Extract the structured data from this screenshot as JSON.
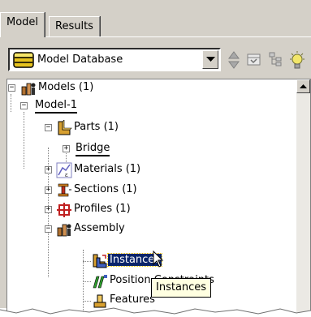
{
  "tabs": [
    {
      "label": "Model",
      "active": true
    },
    {
      "label": "Results",
      "active": false
    }
  ],
  "toolbar": {
    "database_combo": {
      "value": "Model Database",
      "icon": "database-icon"
    },
    "buttons": [
      "up-down-arrows-icon",
      "filter-tree-icon",
      "hierarchy-icon",
      "light-bulb-icon"
    ]
  },
  "tree": {
    "models": {
      "label": "Models (1)",
      "expanded": true
    },
    "model": {
      "label": "Model-1",
      "expanded": true
    },
    "parts": {
      "label": "Parts (1)",
      "expanded": true
    },
    "bridge": {
      "label": "Bridge",
      "expanded": false
    },
    "materials": {
      "label": "Materials (1)"
    },
    "sections": {
      "label": "Sections (1)"
    },
    "profiles": {
      "label": "Profiles (1)"
    },
    "assembly": {
      "label": "Assembly",
      "expanded": true
    },
    "instances": {
      "label": "Instances",
      "selected": true
    },
    "positions": {
      "label": "Position Constraints"
    },
    "features": {
      "label": "Features"
    }
  },
  "tooltip": {
    "text": "Instances"
  },
  "colors": {
    "selection": "#0a246a",
    "tooltip_bg": "#ffffe1",
    "panel_bg": "#d4d0c8"
  }
}
